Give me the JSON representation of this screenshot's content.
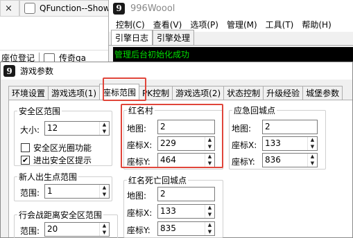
{
  "bg_tabs": [
    {
      "label": "",
      "close": "×"
    },
    {
      "label": "QFunction--Showl",
      "close": ""
    }
  ],
  "bg_row": {
    "item1": "座位登记",
    "item2": "传奇ga"
  },
  "app": {
    "title": "996Woool",
    "menu": [
      "控制(C)",
      "查看(V)",
      "选项(P)",
      "管理(M)",
      "工具(T)",
      "帮助(H)"
    ],
    "tabs": [
      "引擎日志",
      "引擎处理"
    ],
    "log_text": "管理后台初始化成功"
  },
  "dialog": {
    "title": "游戏参数",
    "tabs": [
      "环境设置",
      "游戏选项(1)",
      "座标范围",
      "PK控制",
      "游戏选项(2)",
      "状态控制",
      "升级经验",
      "城堡参数"
    ],
    "active_tab": 2,
    "safe_zone": {
      "title": "安全区范围",
      "size_label": "大小:",
      "size_value": "12",
      "ring_label": "安全区光圈功能",
      "ring_checked": false,
      "prompt_label": "进出安全区提示",
      "prompt_checked": true
    },
    "newbie": {
      "title": "新人出生点范围",
      "range_label": "范围:",
      "range_value": "1"
    },
    "war": {
      "title": "行会战距离安全区范围",
      "range_label": "范围:",
      "range_value": "20"
    },
    "red_village": {
      "title": "红名村",
      "map_label": "地图:",
      "map_value": "2",
      "x_label": "座标X:",
      "x_value": "229",
      "y_label": "座标Y:",
      "y_value": "464"
    },
    "red_death": {
      "title": "红名死亡回城点",
      "map_label": "地图:",
      "map_value": "2",
      "x_label": "座标X:",
      "x_value": "133",
      "y_label": "座标Y:",
      "y_value": "835"
    },
    "return_point": {
      "title": "应急回城点",
      "map_label": "地图:",
      "map_value": "2",
      "x_label": "座标X:",
      "x_value": "133",
      "y_label": "座标Y:",
      "y_value": "836"
    }
  },
  "colors": {
    "highlight": "#e0453a",
    "log_text": "#00e000",
    "log_bg": "#000000"
  }
}
